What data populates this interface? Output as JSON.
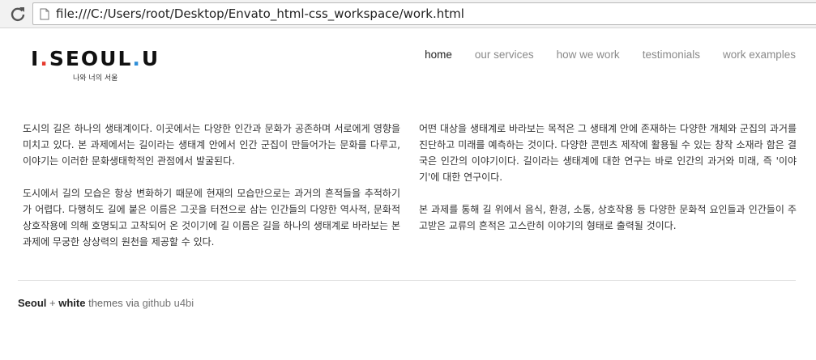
{
  "browser": {
    "url": "file:///C:/Users/root/Desktop/Envato_html-css_workspace/work.html"
  },
  "logo": {
    "part1": "I",
    "dot1": ".",
    "part2": "SEOUL",
    "dot2": ".",
    "part3": "U",
    "subtitle": "나와 너의 서울"
  },
  "nav": {
    "items": [
      {
        "label": "home",
        "active": true
      },
      {
        "label": "our services",
        "active": false
      },
      {
        "label": "how we work",
        "active": false
      },
      {
        "label": "testimonials",
        "active": false
      },
      {
        "label": "work examples",
        "active": false
      }
    ]
  },
  "content": {
    "left": [
      "도시의 길은 하나의 생태계이다. 이곳에서는 다양한 인간과 문화가 공존하며 서로에게 영향을 미치고 있다. 본 과제에서는 길이라는 생태계 안에서 인간 군집이 만들어가는 문화를 다루고, 이야기는 이러한 문화생태학적인 관점에서 발굴된다.",
      "도시에서 길의 모습은 항상 변화하기 때문에 현재의 모습만으로는 과거의 흔적들을 추적하기가 어렵다. 다행히도 길에 붙은 이름은 그곳을 터전으로 삼는 인간들의 다양한 역사적, 문화적 상호작용에 의해 호명되고 고착되어 온 것이기에 길 이름은 길을 하나의 생태계로 바라보는 본 과제에 무궁한 상상력의 원천을 제공할 수 있다."
    ],
    "right": [
      "어떤 대상을 생태계로 바라보는 목적은 그 생태계 안에 존재하는 다양한 개체와 군집의 과거를 진단하고 미래를 예측하는 것이다. 다양한 콘텐츠 제작에 활용될 수 있는 창작 소재라 함은 결국은 인간의 이야기이다. 길이라는 생태계에 대한 연구는 바로 인간의 과거와 미래, 즉 '이야기'에 대한 연구이다.",
      "본 과제를 통해 길 위에서 음식, 환경, 소통, 상호작용 등 다양한 문화적 요인들과 인간들이 주고받은 교류의 흔적은 고스란히 이야기의 형태로 출력될 것이다."
    ]
  },
  "footer": {
    "bold1": "Seoul",
    "plus": " + ",
    "bold2": "white",
    "text": " themes via ",
    "link": "github u4bi"
  },
  "colors": {
    "logo_dot_red": "#e63a2e",
    "logo_dot_blue": "#2f8fd8",
    "nav_active": "#222222",
    "nav_inactive": "#8a8a8a"
  }
}
